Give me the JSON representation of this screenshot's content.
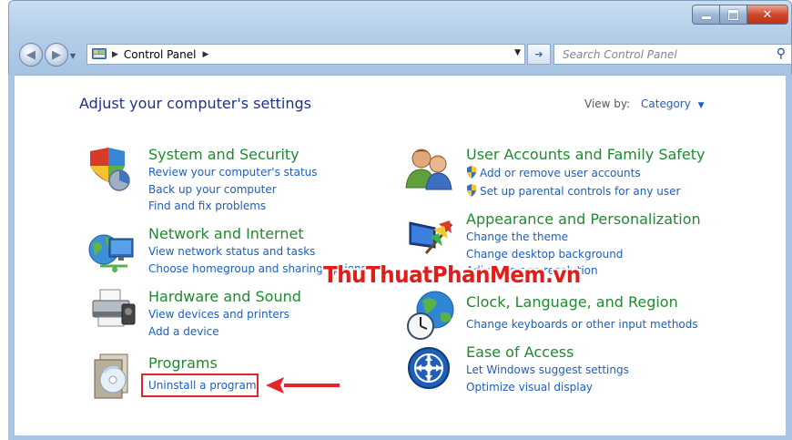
{
  "address": {
    "root_label": "Control Panel"
  },
  "search": {
    "placeholder": "Search Control Panel"
  },
  "page": {
    "heading": "Adjust your computer's settings",
    "view_by_label": "View by:",
    "view_by_value": "Category"
  },
  "left_categories": [
    {
      "title": "System and Security",
      "links": [
        "Review your computer's status",
        "Back up your computer",
        "Find and fix problems"
      ]
    },
    {
      "title": "Network and Internet",
      "links": [
        "View network status and tasks",
        "Choose homegroup and sharing options"
      ]
    },
    {
      "title": "Hardware and Sound",
      "links": [
        "View devices and printers",
        "Add a device"
      ]
    },
    {
      "title": "Programs",
      "links": [
        "Uninstall a program"
      ]
    }
  ],
  "right_categories": [
    {
      "title": "User Accounts and Family Safety",
      "links": [
        "Add or remove user accounts",
        "Set up parental controls for any user"
      ]
    },
    {
      "title": "Appearance and Personalization",
      "links": [
        "Change the theme",
        "Change desktop background",
        "Adjust screen resolution"
      ]
    },
    {
      "title": "Clock, Language, and Region",
      "links": [
        "Change keyboards or other input methods"
      ]
    },
    {
      "title": "Ease of Access",
      "links": [
        "Let Windows suggest settings",
        "Optimize visual display"
      ]
    }
  ],
  "watermark": "ThuThuatPhanMem.vn",
  "colors": {
    "category_title": "#1f8a2f",
    "link": "#1c5ec0",
    "highlight": "#e4262c"
  },
  "icons": [
    "shield-icon",
    "network-icon",
    "printer-icon",
    "programs-icon",
    "users-icon",
    "appearance-icon",
    "clock-globe-icon",
    "ease-of-access-icon",
    "uac-shield-icon",
    "search-icon",
    "refresh-icon",
    "back-icon",
    "forward-icon"
  ]
}
